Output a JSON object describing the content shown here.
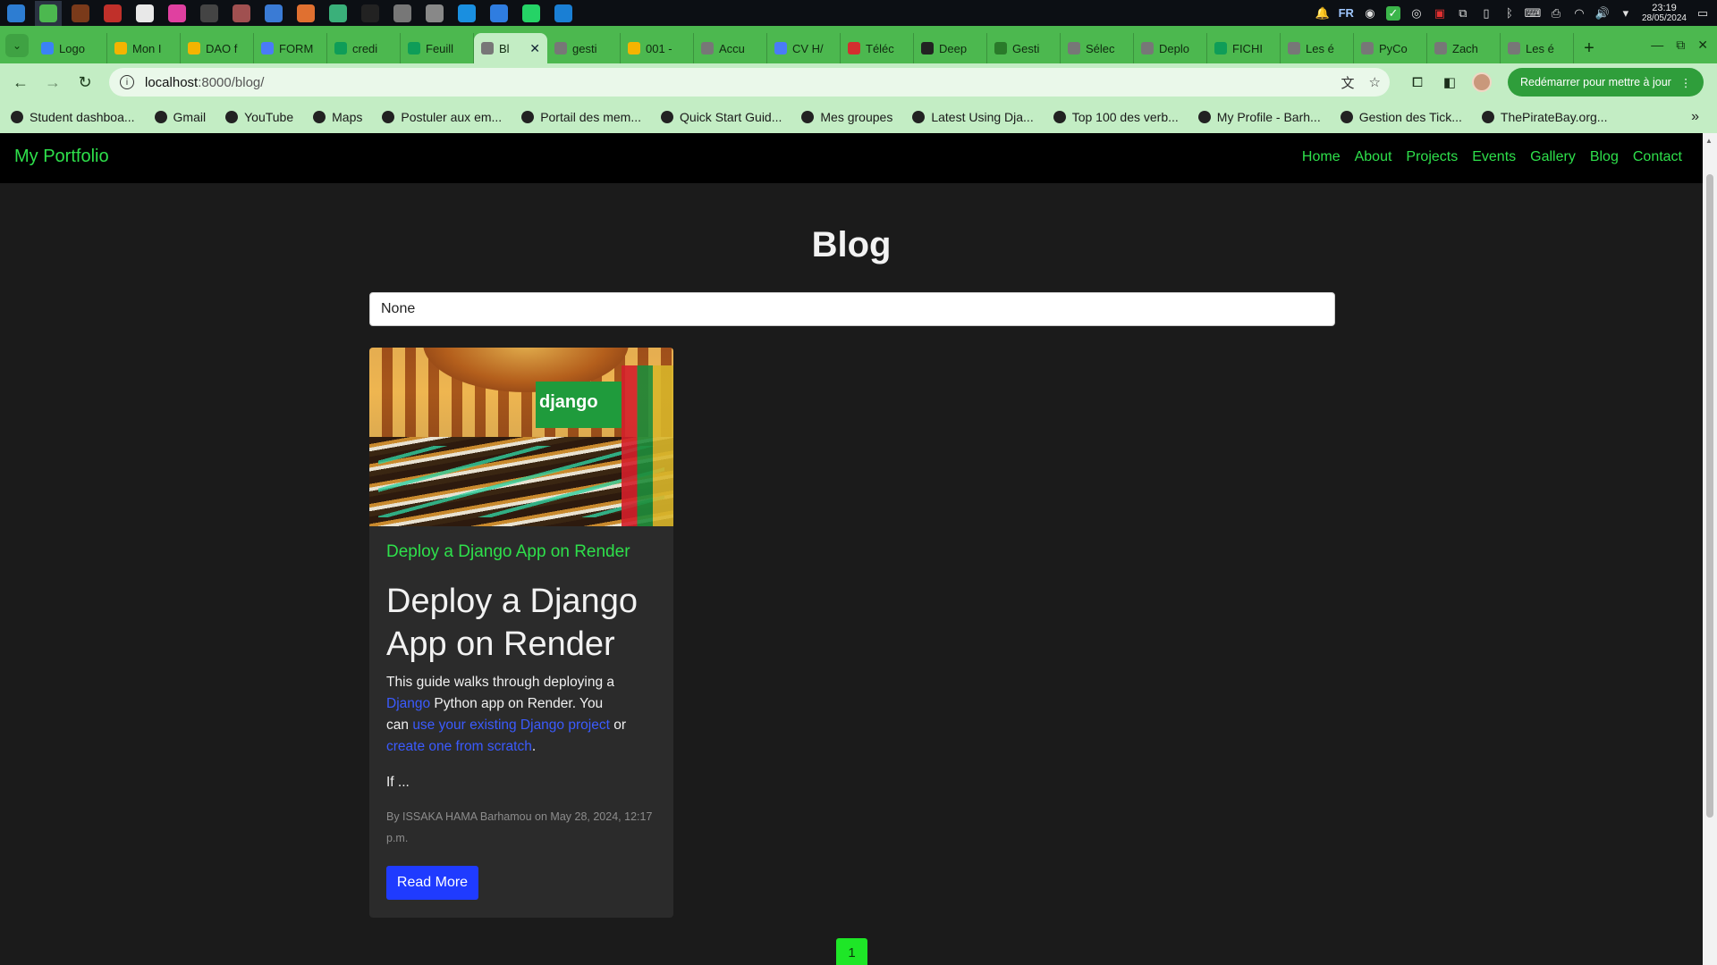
{
  "os": {
    "apps": [
      {
        "name": "app-launcher-icon",
        "color": "#2d7dd2"
      },
      {
        "name": "chrome-icon",
        "color": "#4cb84f",
        "active": true
      },
      {
        "name": "app-icon",
        "color": "#7a3a1a"
      },
      {
        "name": "app-icon",
        "color": "#c0302a"
      },
      {
        "name": "app-icon",
        "color": "#e8e8e8"
      },
      {
        "name": "app-icon",
        "color": "#e040a0"
      },
      {
        "name": "app-icon",
        "color": "#444"
      },
      {
        "name": "app-icon",
        "color": "#a05050"
      },
      {
        "name": "app-icon",
        "color": "#3a7bd5"
      },
      {
        "name": "app-icon",
        "color": "#e07030"
      },
      {
        "name": "app-icon",
        "color": "#3ab07a"
      },
      {
        "name": "terminal-icon",
        "color": "#222"
      },
      {
        "name": "app-icon",
        "color": "#777"
      },
      {
        "name": "files-icon",
        "color": "#888"
      },
      {
        "name": "skype-icon",
        "color": "#1a8fe0"
      },
      {
        "name": "messenger-icon",
        "color": "#2f7de0"
      },
      {
        "name": "whatsapp-icon",
        "color": "#25d366"
      },
      {
        "name": "vscode-icon",
        "color": "#1a7fd4"
      }
    ],
    "tray": {
      "lang": "FR",
      "time": "23:19",
      "date": "28/05/2024"
    }
  },
  "browser": {
    "tabs": [
      {
        "title": "Logo",
        "color": "#3b82f6"
      },
      {
        "title": "Mon I",
        "color": "#f4b400"
      },
      {
        "title": "DAO f",
        "color": "#f4b400"
      },
      {
        "title": "FORM",
        "color": "#4a7bf7"
      },
      {
        "title": "credi",
        "color": "#0f9d58"
      },
      {
        "title": "Feuill",
        "color": "#0f9d58"
      },
      {
        "title": "Bl",
        "color": "#777",
        "active": true
      },
      {
        "title": "gesti",
        "color": "#777"
      },
      {
        "title": "001 -",
        "color": "#f4b400"
      },
      {
        "title": "Accu",
        "color": "#777"
      },
      {
        "title": "CV H/",
        "color": "#4a7bf7"
      },
      {
        "title": "Téléc",
        "color": "#d32f2f"
      },
      {
        "title": "Deep",
        "color": "#222"
      },
      {
        "title": "Gesti",
        "color": "#2a7a2a"
      },
      {
        "title": "Sélec",
        "color": "#777"
      },
      {
        "title": "Deplo",
        "color": "#777"
      },
      {
        "title": "FICHI",
        "color": "#0f9d58"
      },
      {
        "title": "Les é",
        "color": "#777"
      },
      {
        "title": "PyCo",
        "color": "#777"
      },
      {
        "title": "Zach",
        "color": "#777"
      },
      {
        "title": "Les é",
        "color": "#777"
      }
    ],
    "url_host": "localhost",
    "url_path": ":8000/blog/",
    "update_label": "Redémarrer pour mettre à jour",
    "bookmarks": [
      "Student dashboa...",
      "Gmail",
      "YouTube",
      "Maps",
      "Postuler aux em...",
      "Portail des mem...",
      "Quick Start Guid...",
      "Mes groupes",
      "Latest Using Dja...",
      "Top 100 des verb...",
      "My Profile - Barh...",
      "Gestion des Tick...",
      "ThePirateBay.org..."
    ]
  },
  "site": {
    "brand": "My Portfolio",
    "nav": [
      "Home",
      "About",
      "Projects",
      "Events",
      "Gallery",
      "Blog",
      "Contact"
    ],
    "page_title": "Blog",
    "search_value": "None",
    "post": {
      "image_logo_text": "django",
      "subtitle": "Deploy a Django App on Render",
      "title": "Deploy a Django App on Render",
      "excerpt_1": "This guide walks through deploying a ",
      "link_django": "Django",
      "excerpt_2": " Python app on Render. You can ",
      "link_existing": "use your existing Django project",
      "excerpt_3": " or ",
      "link_scratch": "create one from scratch",
      "excerpt_4": ".",
      "ellipsis": "If ...",
      "meta": "By ISSAKA HAMA Barhamou on May 28, 2024, 12:17 p.m.",
      "read_more": "Read More"
    },
    "pagination": [
      "1"
    ]
  },
  "colors": {
    "accent_green": "#2ee04b",
    "link_blue": "#3b5bff",
    "button_blue": "#1f3bff",
    "chrome_green": "#4cb84f"
  }
}
